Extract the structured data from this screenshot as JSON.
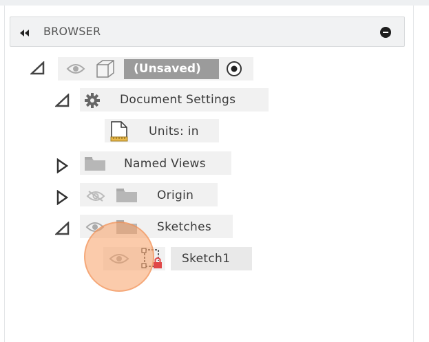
{
  "browser": {
    "title": "BROWSER",
    "collapse_icon": "double-chevron-left-icon",
    "minimize_icon": "minus-circle-icon"
  },
  "tree": {
    "root": {
      "label": "(Unsaved)",
      "expanded": true
    },
    "document_settings": {
      "label": "Document Settings",
      "expanded": true
    },
    "units": {
      "label": "Units: in"
    },
    "named_views": {
      "label": "Named Views",
      "expanded": false
    },
    "origin": {
      "label": "Origin",
      "expanded": false,
      "visible": false
    },
    "sketches": {
      "label": "Sketches",
      "expanded": true
    },
    "sketch1": {
      "label": "Sketch1"
    }
  },
  "colors": {
    "header_bg": "#f1f2f3",
    "row_bg": "#f1f1f1",
    "root_label_bg": "#9b9b9b",
    "cursor_highlight": "#f7a066"
  }
}
